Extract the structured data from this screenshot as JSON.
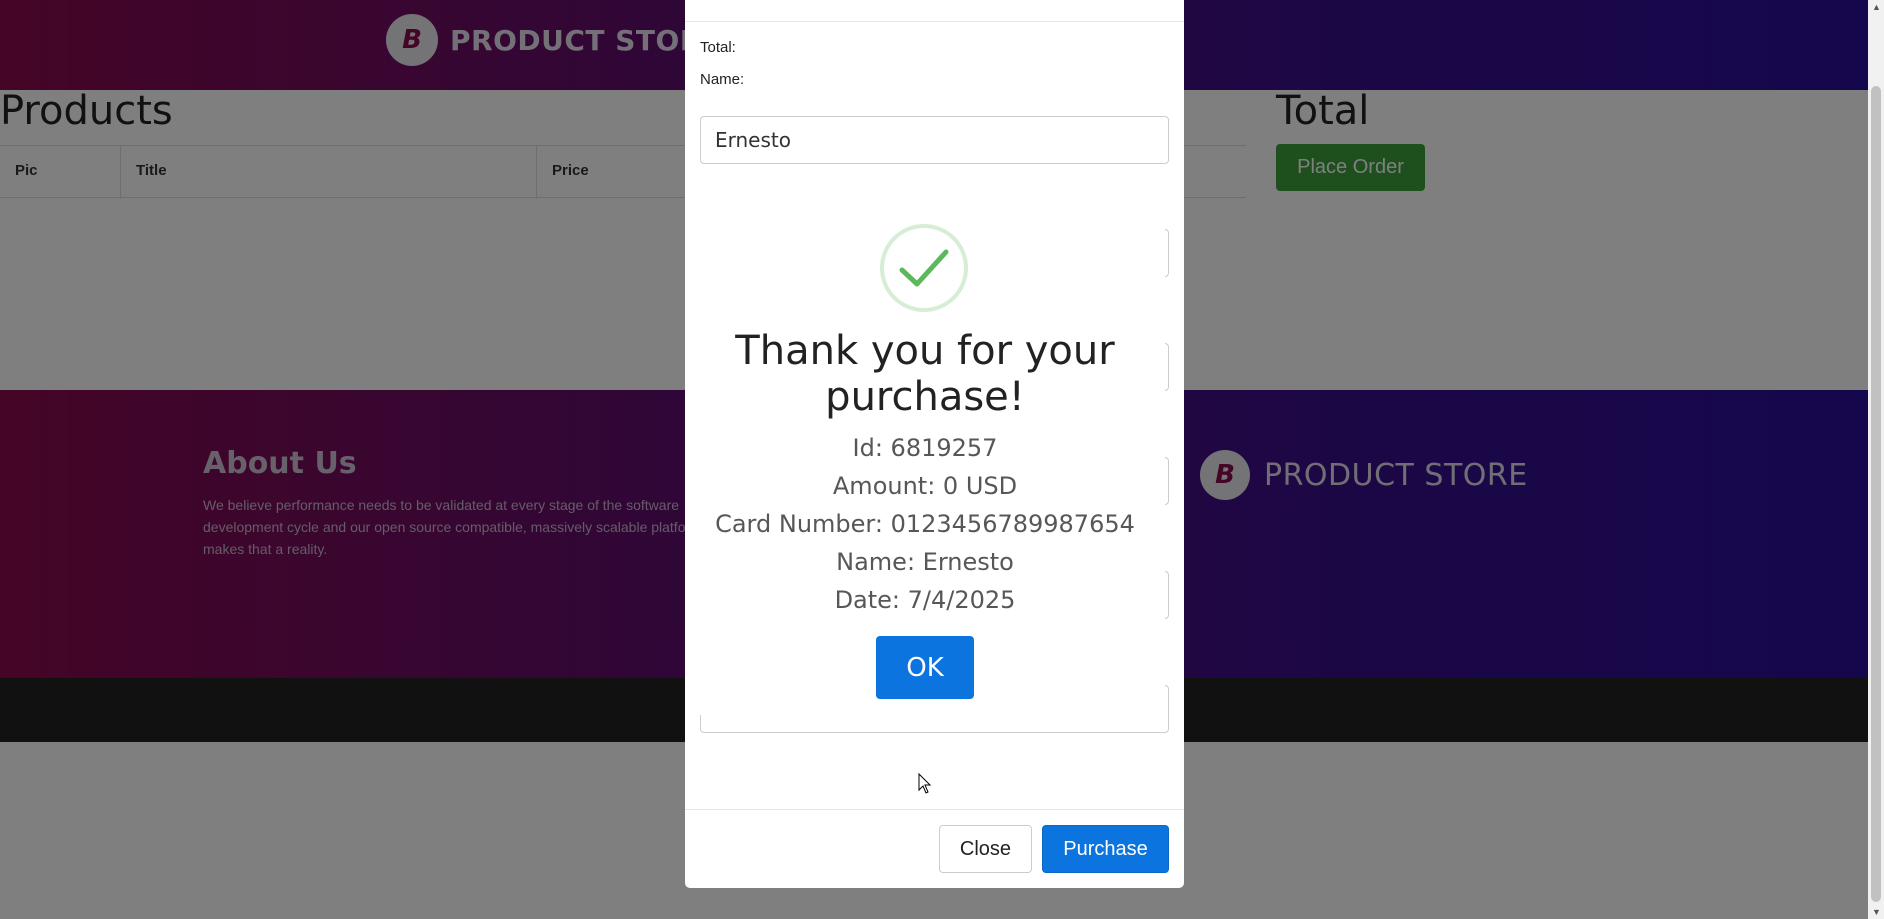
{
  "navbar": {
    "brand": "PRODUCT STORE",
    "logo_letter": "B",
    "logo_icon": "store-logo-icon"
  },
  "products": {
    "title": "Products",
    "columns": [
      "Pic",
      "Title",
      "Price"
    ]
  },
  "total": {
    "title": "Total",
    "place_order_label": "Place Order"
  },
  "footer": {
    "about_title": "About Us",
    "about_text": "We believe performance needs to be validated at every stage of the software development cycle and our open source compatible, massively scalable platform makes that a reality.",
    "brand": "PRODUCT STORE",
    "logo_letter": "B"
  },
  "modal": {
    "total_label": "Total:",
    "name_label": "Name:",
    "name_value": "Ernesto",
    "close_label": "Close",
    "purchase_label": "Purchase"
  },
  "alert": {
    "title": "Thank you for your purchase!",
    "lines": [
      "Id: 6819257",
      "Amount: 0 USD",
      "Card Number: 0123456789987654",
      "Name: Ernesto",
      "Date: 7/4/2025"
    ],
    "ok_label": "OK",
    "icon": "success-check-icon",
    "accent_color": "#5cb85c"
  },
  "colors": {
    "primary_button": "#0b74de",
    "success_button": "#3aa03a",
    "gradient_start": "#8a0a4d",
    "gradient_end": "#2b0f9a"
  }
}
